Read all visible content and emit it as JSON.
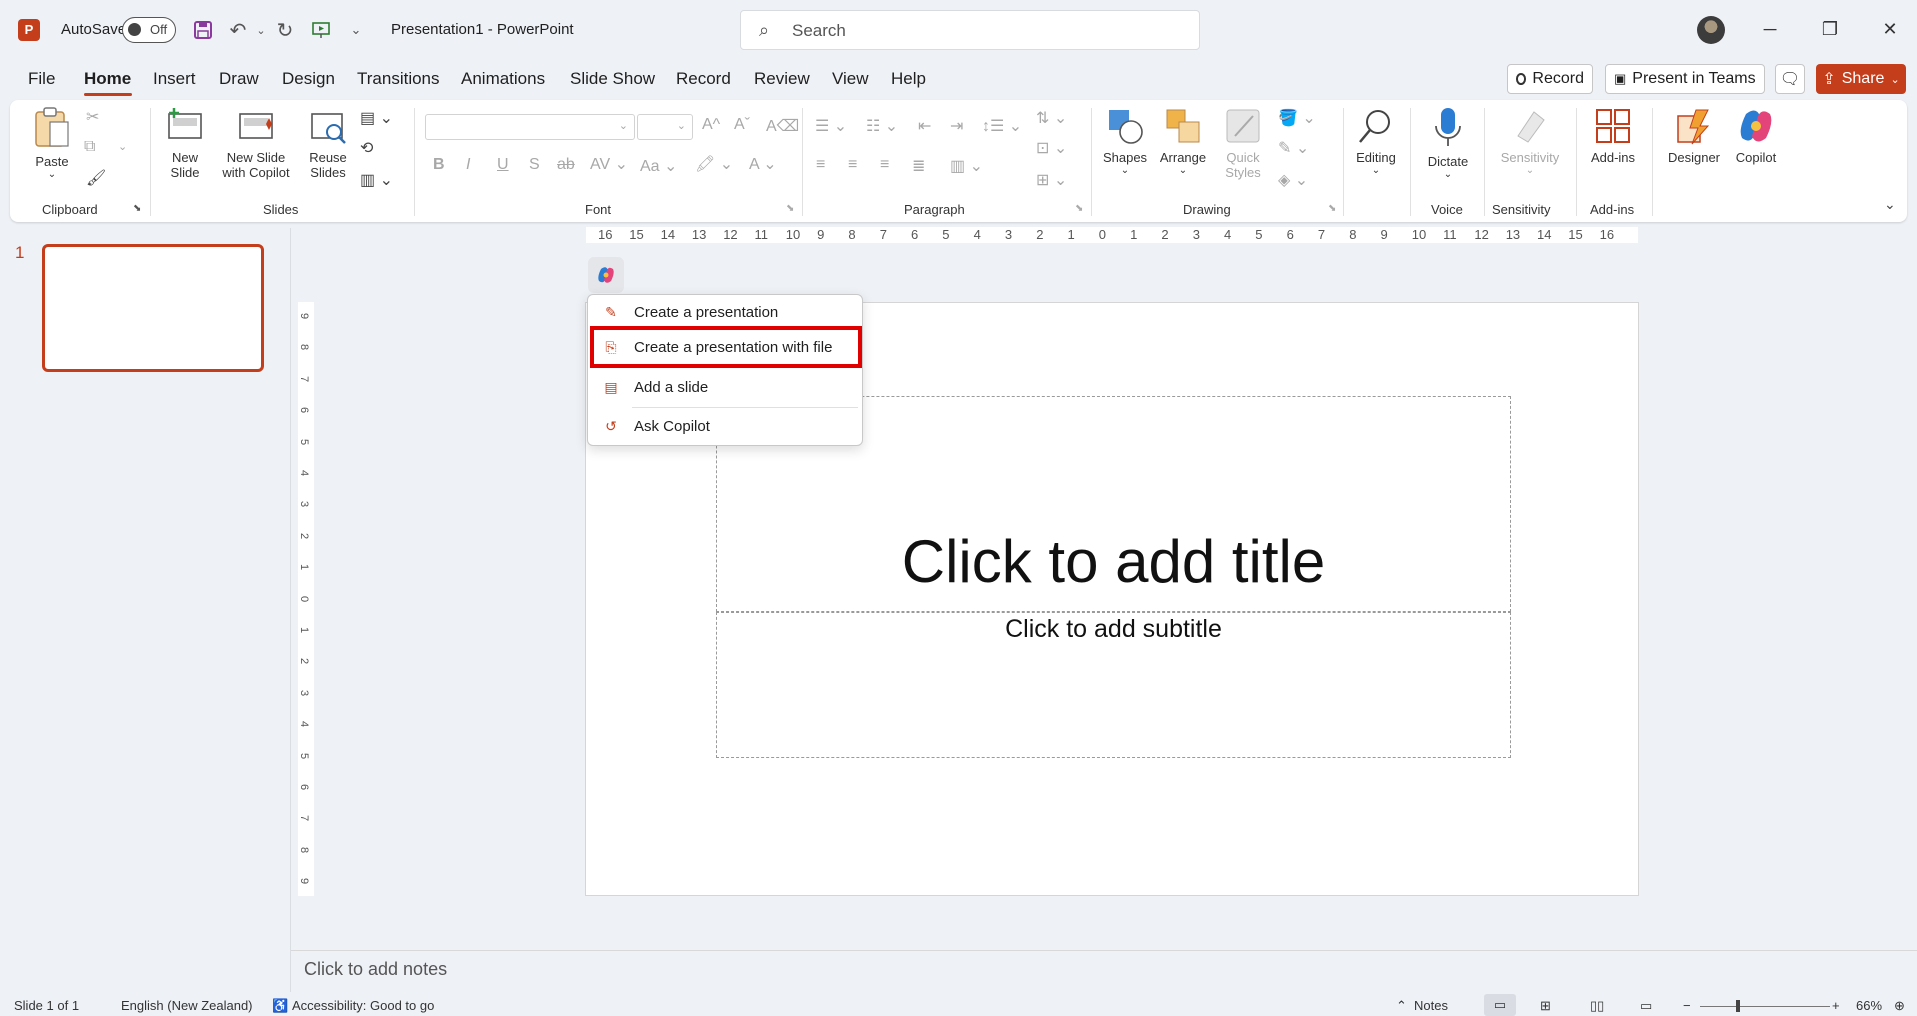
{
  "app": {
    "logo_letter": "P",
    "autosave_label": "AutoSave",
    "autosave_state": "Off",
    "document_title": "Presentation1  -  PowerPoint",
    "search_placeholder": "Search",
    "window_controls": [
      "─",
      "❐",
      "✕"
    ]
  },
  "menu": {
    "tabs": [
      "File",
      "Home",
      "Insert",
      "Draw",
      "Design",
      "Transitions",
      "Animations",
      "Slide Show",
      "Record",
      "Review",
      "View",
      "Help"
    ],
    "active_tab": "Home",
    "record_label": "Record",
    "present_label": "Present in Teams",
    "share_label": "Share"
  },
  "ribbon": {
    "clipboard": {
      "paste": "Paste",
      "group": "Clipboard"
    },
    "slides": {
      "new_slide_1": "New",
      "new_slide_2": "Slide",
      "with_copilot_1": "New Slide",
      "with_copilot_2": "with Copilot",
      "reuse_1": "Reuse",
      "reuse_2": "Slides",
      "group": "Slides"
    },
    "font": {
      "group": "Font",
      "bold": "B",
      "italic": "I",
      "underline": "U",
      "strike": "S"
    },
    "paragraph": {
      "group": "Paragraph"
    },
    "drawing": {
      "shapes": "Shapes",
      "arrange": "Arrange",
      "quick_1": "Quick",
      "quick_2": "Styles",
      "group": "Drawing"
    },
    "editing": {
      "label": "Editing"
    },
    "voice": {
      "dictate": "Dictate",
      "group": "Voice"
    },
    "sensitivity": {
      "label": "Sensitivity",
      "group": "Sensitivity"
    },
    "addins": {
      "label": "Add-ins",
      "group": "Add-ins"
    },
    "designer": "Designer",
    "copilot": "Copilot"
  },
  "ruler": {
    "horizontal": [
      "16",
      "15",
      "14",
      "13",
      "12",
      "11",
      "10",
      "9",
      "8",
      "7",
      "6",
      "5",
      "4",
      "3",
      "2",
      "1",
      "0",
      "1",
      "2",
      "3",
      "4",
      "5",
      "6",
      "7",
      "8",
      "9",
      "10",
      "11",
      "12",
      "13",
      "14",
      "15",
      "16"
    ],
    "vertical": [
      "9",
      "8",
      "7",
      "6",
      "5",
      "4",
      "3",
      "2",
      "1",
      "0",
      "1",
      "2",
      "3",
      "4",
      "5",
      "6",
      "7",
      "8",
      "9"
    ]
  },
  "thumbnails": {
    "slide_number": "1"
  },
  "slide": {
    "title_placeholder": "Click to add title",
    "subtitle_placeholder": "Click to add subtitle"
  },
  "copilot_menu": {
    "items": [
      {
        "label": "Create a presentation",
        "icon": "pen-sparkle-icon"
      },
      {
        "label": "Create a presentation with file",
        "icon": "file-copilot-icon"
      },
      {
        "label": "Add a slide",
        "icon": "slide-add-icon"
      },
      {
        "label": "Ask Copilot",
        "icon": "copilot-chat-icon"
      }
    ],
    "highlighted_index": 1,
    "highlight_color": "#e00000"
  },
  "notes": {
    "placeholder": "Click to add notes"
  },
  "status": {
    "slide_info": "Slide 1 of 1",
    "language": "English (New Zealand)",
    "accessibility": "Accessibility: Good to go",
    "notes": "Notes",
    "zoom": "66%"
  },
  "colors": {
    "accent": "#c43e1c",
    "background": "#eef1f6"
  }
}
